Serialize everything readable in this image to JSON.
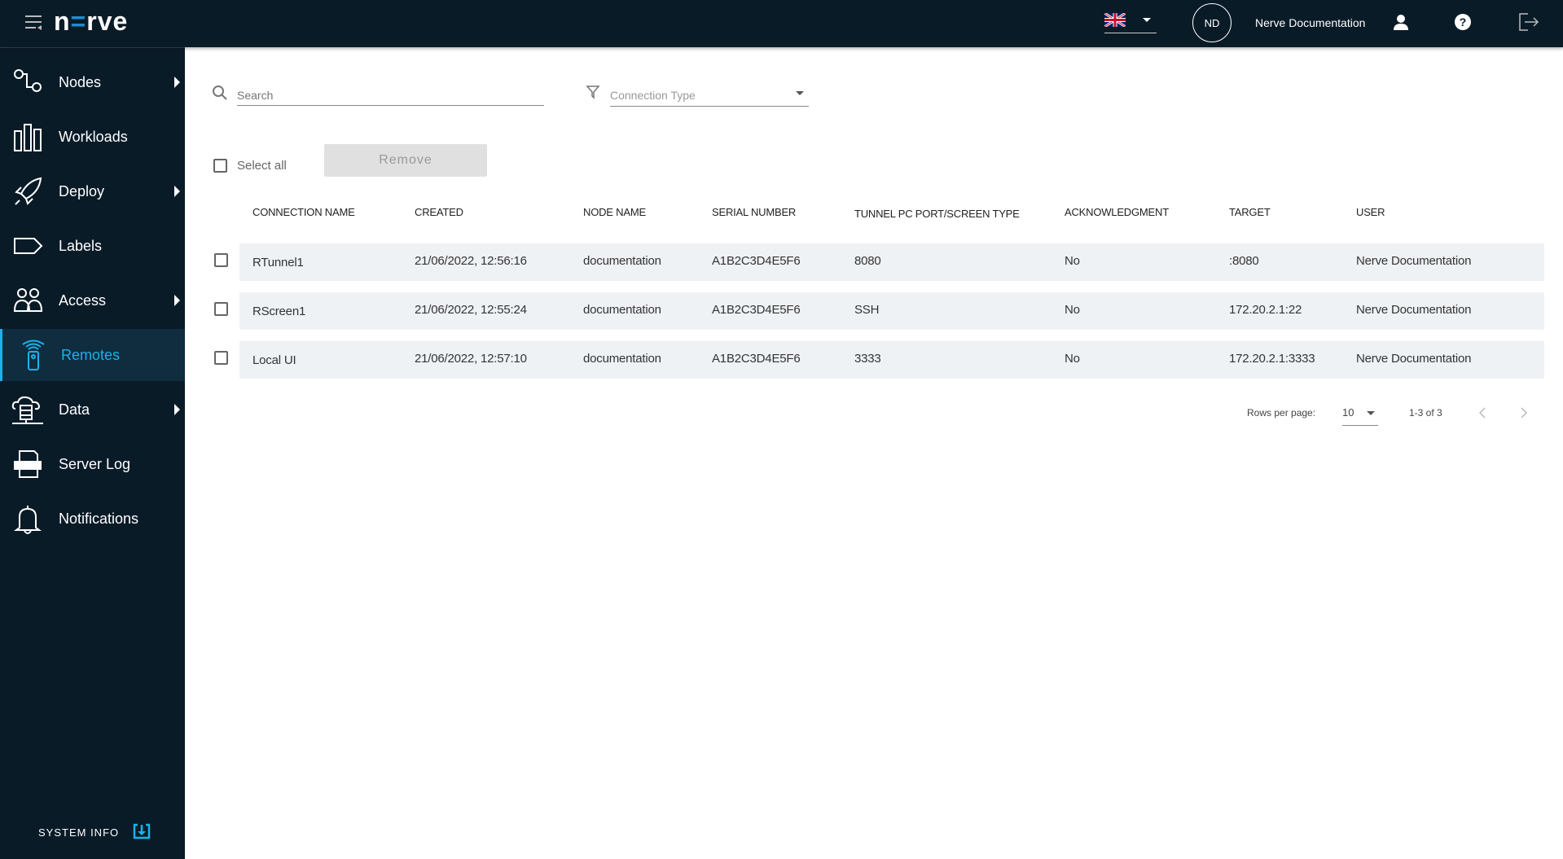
{
  "header": {
    "logo": "nerve",
    "language": "English (UK)",
    "avatar_initials": "ND",
    "user_name": "Nerve Documentation"
  },
  "sidebar": {
    "items": [
      {
        "label": "Nodes",
        "icon": "nodes-icon",
        "has_submenu": true
      },
      {
        "label": "Workloads",
        "icon": "workloads-icon",
        "has_submenu": false
      },
      {
        "label": "Deploy",
        "icon": "rocket-icon",
        "has_submenu": true
      },
      {
        "label": "Labels",
        "icon": "label-icon",
        "has_submenu": false
      },
      {
        "label": "Access",
        "icon": "users-icon",
        "has_submenu": true
      },
      {
        "label": "Remotes",
        "icon": "remote-icon",
        "has_submenu": false,
        "active": true
      },
      {
        "label": "Data",
        "icon": "cloud-database-icon",
        "has_submenu": true
      },
      {
        "label": "Server Log",
        "icon": "log-icon",
        "has_submenu": false
      },
      {
        "label": "Notifications",
        "icon": "bell-icon",
        "has_submenu": false
      }
    ],
    "system_info": "SYSTEM INFO"
  },
  "toolbar": {
    "search_placeholder": "Search",
    "filter_placeholder": "Connection Type",
    "select_all": "Select all",
    "remove": "Remove"
  },
  "table": {
    "columns": [
      "CONNECTION NAME",
      "CREATED",
      "NODE NAME",
      "SERIAL NUMBER",
      "TUNNEL PC PORT/SCREEN TYPE",
      "ACKNOWLEDGMENT",
      "TARGET",
      "USER"
    ],
    "rows": [
      [
        "RTunnel1",
        "21/06/2022, 12:56:16",
        "documentation",
        "A1B2C3D4E5F6",
        "8080",
        "No",
        ":8080",
        "Nerve Documentation"
      ],
      [
        "RScreen1",
        "21/06/2022, 12:55:24",
        "documentation",
        "A1B2C3D4E5F6",
        "SSH",
        "No",
        "172.20.2.1:22",
        "Nerve Documentation"
      ],
      [
        "Local UI",
        "21/06/2022, 12:57:10",
        "documentation",
        "A1B2C3D4E5F6",
        "3333",
        "No",
        "172.20.2.1:3333",
        "Nerve Documentation"
      ]
    ]
  },
  "pagination": {
    "rows_per_page_label": "Rows per page:",
    "rows_per_page": "10",
    "range": "1-3 of 3"
  },
  "colors": {
    "header_bg": "#0a1b28",
    "accent": "#1ab2e8",
    "row_bg": "#eff2f5"
  }
}
